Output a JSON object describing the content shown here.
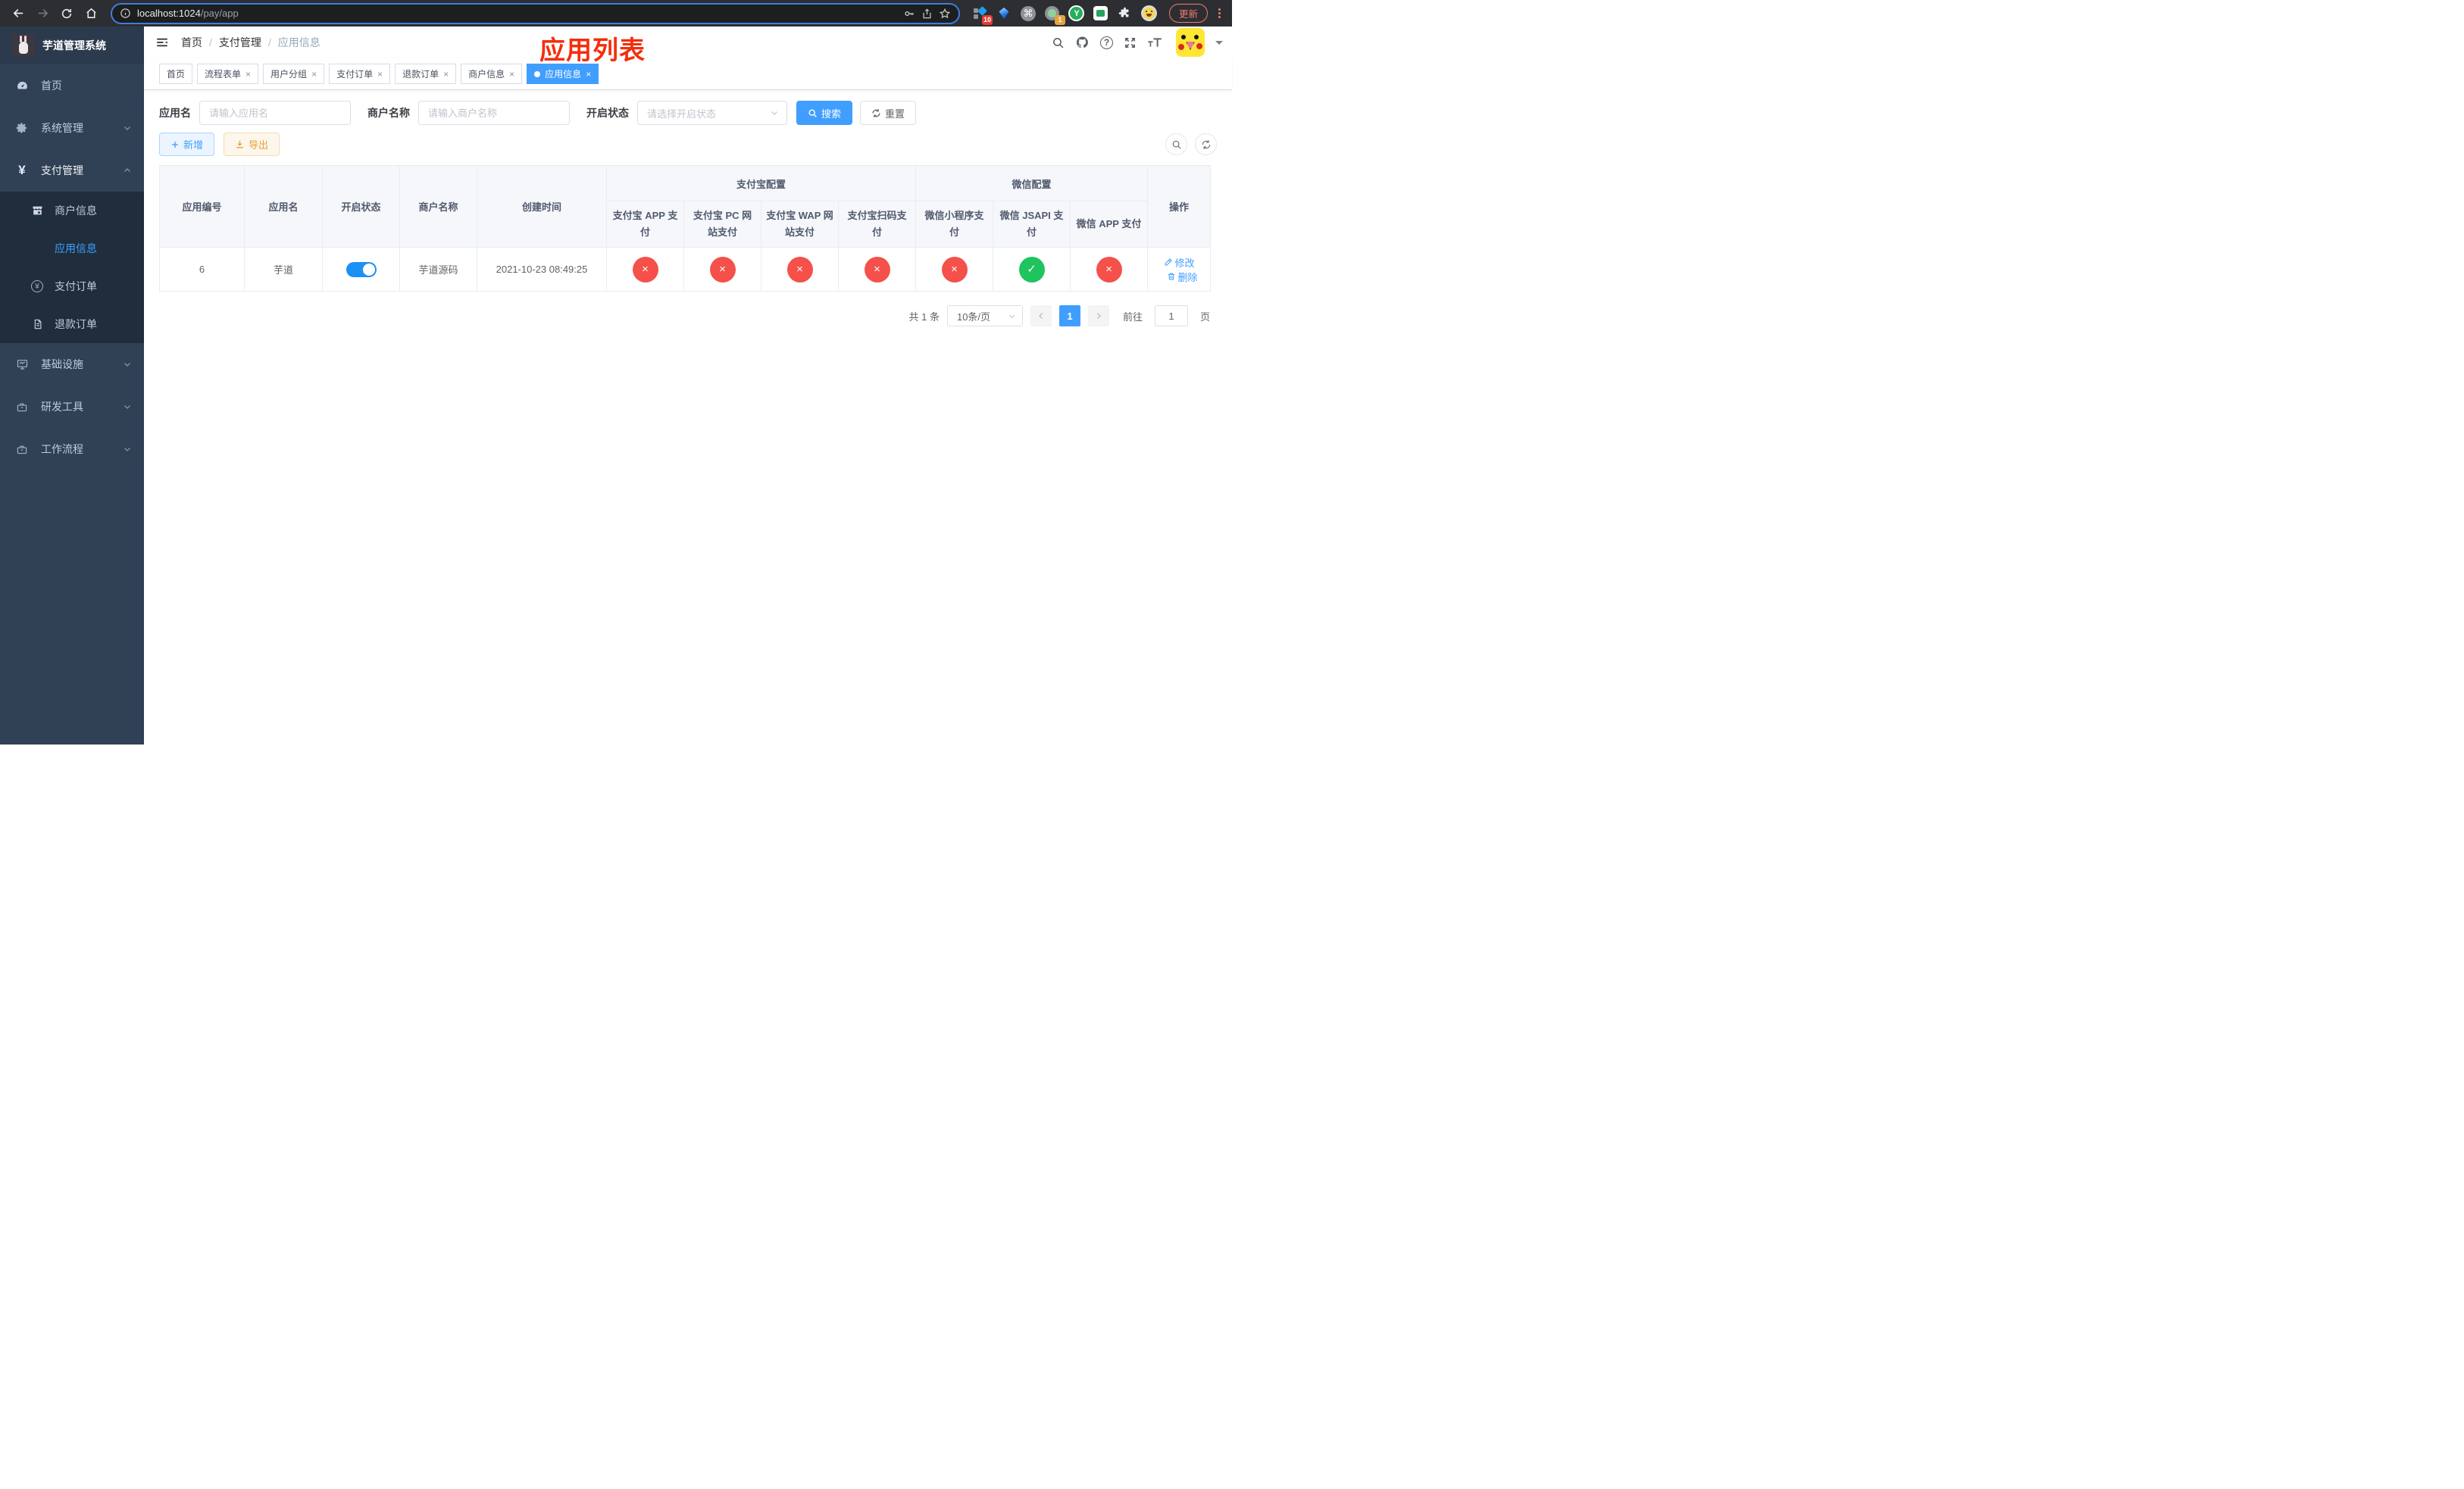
{
  "colors": {
    "accent": "#409eff",
    "success": "#1fc45f",
    "danger": "#f5504a",
    "warning": "#e6a23c",
    "annotation": "#f42e0d",
    "sidebar_bg": "#304156",
    "submenu_bg": "#1f2d3d"
  },
  "icons": {
    "close": "×",
    "check": "✓",
    "cross": "×",
    "yen": "¥",
    "question": "?",
    "command": "⌘",
    "y_badge": "Y"
  },
  "browser": {
    "url_host": "localhost:1024",
    "url_path": "/pay/app",
    "update_label": "更新",
    "ext_badge_blocks": "10",
    "ext_badge_meet": "1"
  },
  "sidebar": {
    "title": "芋道管理系统",
    "items": {
      "home": "首页",
      "system": "系统管理",
      "payment": "支付管理",
      "merchant": "商户信息",
      "app_info": "应用信息",
      "pay_order": "支付订单",
      "refund_order": "退款订单",
      "infra": "基础设施",
      "dev_tools": "研发工具",
      "workflow": "工作流程"
    }
  },
  "navbar": {
    "breadcrumb": [
      "首页",
      "支付管理",
      "应用信息"
    ]
  },
  "overlay_title": "应用列表",
  "tabs": [
    {
      "label": "首页"
    },
    {
      "label": "流程表单"
    },
    {
      "label": "用户分组"
    },
    {
      "label": "支付订单"
    },
    {
      "label": "退款订单"
    },
    {
      "label": "商户信息"
    },
    {
      "label": "应用信息"
    }
  ],
  "filters": {
    "app_name_label": "应用名",
    "app_name_placeholder": "请输入应用名",
    "merchant_label": "商户名称",
    "merchant_placeholder": "请输入商户名称",
    "status_label": "开启状态",
    "status_placeholder": "请选择开启状态",
    "search": "搜索",
    "reset": "重置"
  },
  "toolbar": {
    "add": "新增",
    "export": "导出"
  },
  "table": {
    "cols": [
      "应用编号",
      "应用名",
      "开启状态",
      "商户名称",
      "创建时间"
    ],
    "group_alipay": "支付宝配置",
    "group_wechat": "微信配置",
    "pay_cols": [
      "支付宝 APP 支付",
      "支付宝 PC 网站支付",
      "支付宝 WAP 网站支付",
      "支付宝扫码支付",
      "微信小程序支付",
      "微信 JSAPI 支付",
      "微信 APP 支付"
    ],
    "op_col": "操作",
    "row": {
      "id": "6",
      "name": "芋道",
      "merchant": "芋道源码",
      "created": "2021-10-23 08:49:25",
      "pay": [
        {
          "state": "fail",
          "glyph": "×"
        },
        {
          "state": "fail",
          "glyph": "×"
        },
        {
          "state": "fail",
          "glyph": "×"
        },
        {
          "state": "fail",
          "glyph": "×"
        },
        {
          "state": "fail",
          "glyph": "×"
        },
        {
          "state": "success",
          "glyph": "✓"
        },
        {
          "state": "fail",
          "glyph": "×"
        }
      ],
      "edit": "修改",
      "delete": "删除"
    }
  },
  "pagination": {
    "total": "共 1 条",
    "page_size": "10条/页",
    "page": "1",
    "goto": "前往",
    "unit": "页",
    "goto_value": "1"
  }
}
